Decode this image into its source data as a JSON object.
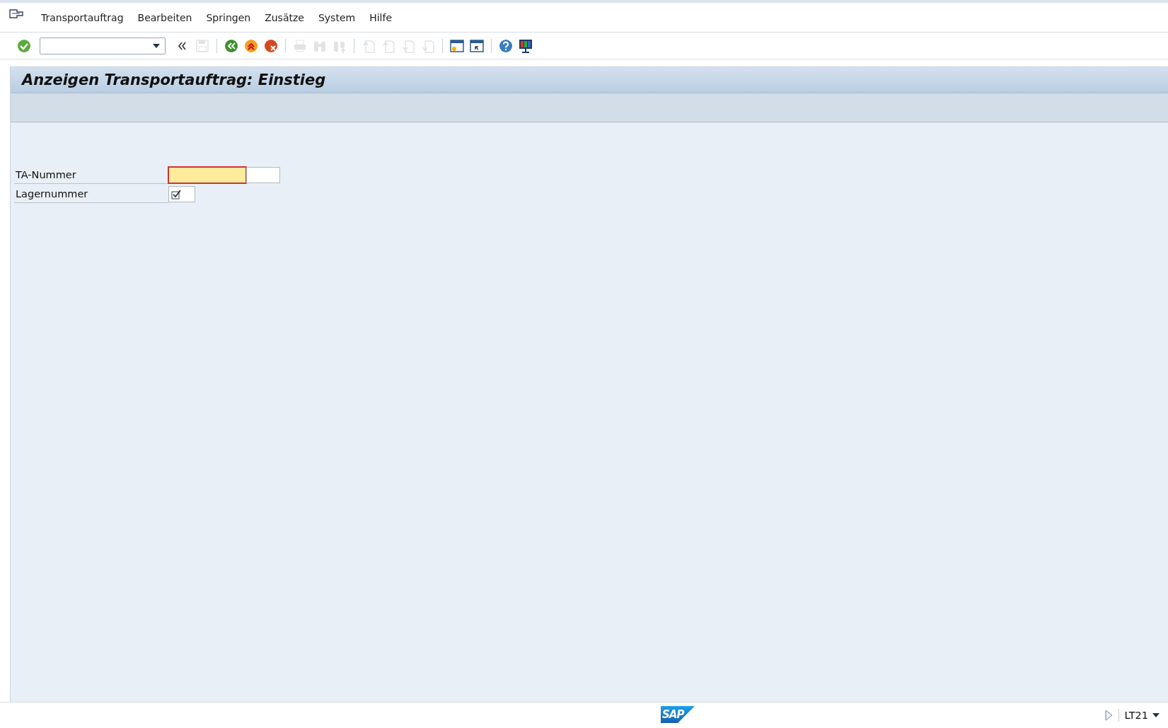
{
  "menu_bar": {
    "items": [
      {
        "label": "Transportauftrag"
      },
      {
        "label": "Bearbeiten"
      },
      {
        "label": "Springen"
      },
      {
        "label": "Zusätze"
      },
      {
        "label": "System"
      },
      {
        "label": "Hilfe"
      }
    ]
  },
  "toolbar": {
    "items": [
      {
        "kind": "enter",
        "disabled": false
      },
      {
        "kind": "command-field"
      },
      {
        "kind": "collapse",
        "disabled": false
      },
      {
        "kind": "save",
        "disabled": true
      },
      {
        "kind": "sep"
      },
      {
        "kind": "back",
        "disabled": false
      },
      {
        "kind": "exit",
        "disabled": false
      },
      {
        "kind": "cancel",
        "disabled": false
      },
      {
        "kind": "sep"
      },
      {
        "kind": "print",
        "disabled": true
      },
      {
        "kind": "find",
        "disabled": true
      },
      {
        "kind": "find-next",
        "disabled": true
      },
      {
        "kind": "sep"
      },
      {
        "kind": "first-page",
        "disabled": true
      },
      {
        "kind": "prev-page",
        "disabled": true
      },
      {
        "kind": "next-page",
        "disabled": true
      },
      {
        "kind": "last-page",
        "disabled": true
      },
      {
        "kind": "sep"
      },
      {
        "kind": "new-session",
        "disabled": false
      },
      {
        "kind": "shortcut",
        "disabled": false
      },
      {
        "kind": "sep"
      },
      {
        "kind": "help",
        "disabled": false
      },
      {
        "kind": "layout",
        "disabled": false
      }
    ]
  },
  "title": "Anzeigen Transportauftrag: Einstieg",
  "form": {
    "fields": [
      {
        "label": "TA-Nummer",
        "kind": "number",
        "focused": true
      },
      {
        "label": "Lagernummer",
        "kind": "checkbox",
        "checked": true
      }
    ]
  },
  "status_bar": {
    "logo": "SAP",
    "transaction": "LT21"
  }
}
